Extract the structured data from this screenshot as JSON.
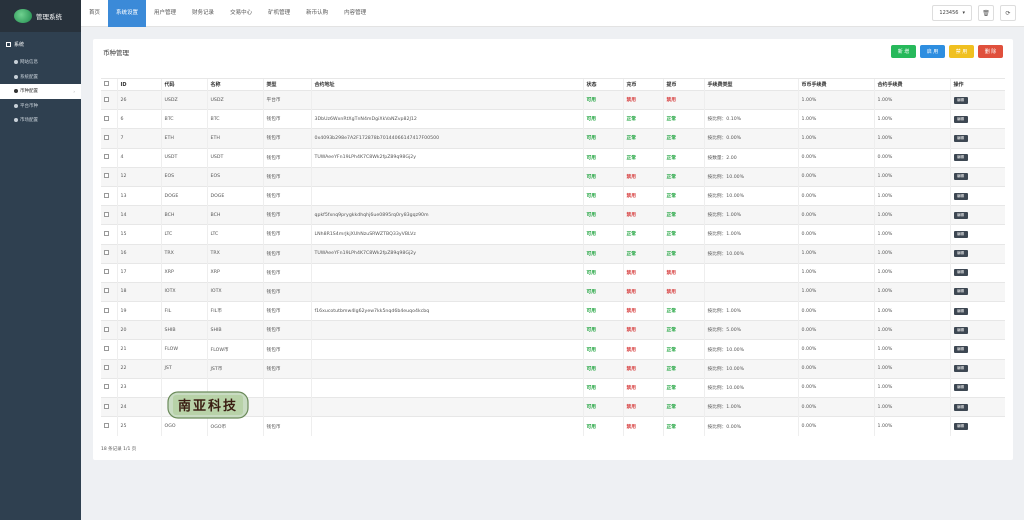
{
  "app": {
    "title": "管理系统"
  },
  "sidebar": {
    "section": "系统",
    "items": [
      {
        "label": "网站信息"
      },
      {
        "label": "系统配置"
      },
      {
        "label": "币种配置"
      },
      {
        "label": "平台币种"
      },
      {
        "label": "市场配置"
      }
    ]
  },
  "topnav": {
    "items": [
      {
        "label": "首页"
      },
      {
        "label": "系统设置"
      },
      {
        "label": "用户管理"
      },
      {
        "label": "财务记录"
      },
      {
        "label": "交易中心"
      },
      {
        "label": "矿机管理"
      },
      {
        "label": "新币认购"
      },
      {
        "label": "内容管理"
      }
    ],
    "user": "123456"
  },
  "panel": {
    "title": "币种管理",
    "actions": {
      "add": "新 增",
      "enable": "启 用",
      "disable": "禁 用",
      "delete": "删 除"
    }
  },
  "colors": {
    "add": "#27b95b",
    "enable": "#2e8ee0",
    "disable": "#f0c020",
    "delete": "#e0503c"
  },
  "table": {
    "headers": [
      "",
      "ID",
      "代码",
      "名称",
      "类型",
      "合约地址",
      "状态",
      "充币",
      "提币",
      "手续费类型",
      "币币手续费",
      "合约手续费",
      "操作"
    ],
    "rows": [
      {
        "id": "26",
        "code": "USDZ",
        "name": "USDZ",
        "type": "平台币",
        "addr": "",
        "status": "可用",
        "dep": "禁用",
        "wd": "禁用",
        "fee": "",
        "spot": "1.00%",
        "contract": "1.00%",
        "op": "编辑"
      },
      {
        "id": "6",
        "code": "BTC",
        "name": "BTC",
        "type": "钱包币",
        "addr": "3DbUz6WxnRtXgTnN4mDgiXkVaNZvp82J12",
        "status": "可用",
        "dep": "正常",
        "wd": "正常",
        "fee": "按比例：0.10%",
        "spot": "1.00%",
        "contract": "1.00%",
        "op": "编辑"
      },
      {
        "id": "7",
        "code": "ETH",
        "name": "ETH",
        "type": "钱包币",
        "addr": "0x4093b298e7A2F172878b70144066147417F00500",
        "status": "可用",
        "dep": "正常",
        "wd": "正常",
        "fee": "按比例：0.00%",
        "spot": "1.00%",
        "contract": "1.00%",
        "op": "编辑"
      },
      {
        "id": "4",
        "code": "USDT",
        "name": "USDT",
        "type": "钱包币",
        "addr": "TUWAeeYFn19LPh4K7C8Wk2fpZ89q98Gj2y",
        "status": "可用",
        "dep": "正常",
        "wd": "正常",
        "fee": "按数量：2.00",
        "spot": "0.00%",
        "contract": "0.00%",
        "op": "编辑"
      },
      {
        "id": "12",
        "code": "EOS",
        "name": "EOS",
        "type": "钱包币",
        "addr": "",
        "status": "可用",
        "dep": "禁用",
        "wd": "正常",
        "fee": "按比例：10.00%",
        "spot": "0.00%",
        "contract": "1.00%",
        "op": "编辑"
      },
      {
        "id": "13",
        "code": "DOGE",
        "name": "DOGE",
        "type": "钱包币",
        "addr": "",
        "status": "可用",
        "dep": "禁用",
        "wd": "正常",
        "fee": "按比例：10.00%",
        "spot": "0.00%",
        "contract": "1.00%",
        "op": "编辑"
      },
      {
        "id": "14",
        "code": "BCH",
        "name": "BCH",
        "type": "钱包币",
        "addr": "qpkf5fxnq9prygkkdhqhj6ue0895rq0ry83gqz90m",
        "status": "可用",
        "dep": "禁用",
        "wd": "正常",
        "fee": "按比例：1.00%",
        "spot": "0.00%",
        "contract": "1.00%",
        "op": "编辑"
      },
      {
        "id": "15",
        "code": "LTC",
        "name": "LTC",
        "type": "钱包币",
        "addr": "LNh8R1S4mrJkjXUhNzuSRWZTBQ33yVBLVz",
        "status": "可用",
        "dep": "正常",
        "wd": "正常",
        "fee": "按比例：1.00%",
        "spot": "0.00%",
        "contract": "1.00%",
        "op": "编辑"
      },
      {
        "id": "16",
        "code": "TRX",
        "name": "TRX",
        "type": "钱包币",
        "addr": "TUWAeeYFn19LPh4K7C8Wk2fpZ89q98Gj2y",
        "status": "可用",
        "dep": "正常",
        "wd": "正常",
        "fee": "按比例：10.00%",
        "spot": "1.00%",
        "contract": "1.00%",
        "op": "编辑"
      },
      {
        "id": "17",
        "code": "XRP",
        "name": "XRP",
        "type": "钱包币",
        "addr": "",
        "status": "可用",
        "dep": "禁用",
        "wd": "禁用",
        "fee": "",
        "spot": "1.00%",
        "contract": "1.00%",
        "op": "编辑"
      },
      {
        "id": "18",
        "code": "IOTX",
        "name": "IOTX",
        "type": "钱包币",
        "addr": "",
        "status": "可用",
        "dep": "禁用",
        "wd": "禁用",
        "fee": "",
        "spot": "1.00%",
        "contract": "1.00%",
        "op": "编辑"
      },
      {
        "id": "19",
        "code": "FIL",
        "name": "FIL币",
        "type": "钱包币",
        "addr": "f16xucotutbmw4lg62yew7kk5nqd6b4euqo4kcbq",
        "status": "可用",
        "dep": "禁用",
        "wd": "正常",
        "fee": "按比例：1.00%",
        "spot": "0.00%",
        "contract": "1.00%",
        "op": "编辑"
      },
      {
        "id": "20",
        "code": "SHIB",
        "name": "SHIB",
        "type": "钱包币",
        "addr": "",
        "status": "可用",
        "dep": "禁用",
        "wd": "正常",
        "fee": "按比例：5.00%",
        "spot": "0.00%",
        "contract": "1.00%",
        "op": "编辑"
      },
      {
        "id": "21",
        "code": "FLOW",
        "name": "FLOW币",
        "type": "钱包币",
        "addr": "",
        "status": "可用",
        "dep": "禁用",
        "wd": "正常",
        "fee": "按比例：10.00%",
        "spot": "0.00%",
        "contract": "1.00%",
        "op": "编辑"
      },
      {
        "id": "22",
        "code": "JST",
        "name": "JST币",
        "type": "钱包币",
        "addr": "",
        "status": "可用",
        "dep": "禁用",
        "wd": "正常",
        "fee": "按比例：10.00%",
        "spot": "0.00%",
        "contract": "1.00%",
        "op": "编辑"
      },
      {
        "id": "23",
        "code": "",
        "name": "",
        "type": "",
        "addr": "",
        "status": "可用",
        "dep": "禁用",
        "wd": "正常",
        "fee": "按比例：10.00%",
        "spot": "0.00%",
        "contract": "1.00%",
        "op": "编辑"
      },
      {
        "id": "24",
        "code": "",
        "name": "",
        "type": "",
        "addr": "",
        "status": "可用",
        "dep": "禁用",
        "wd": "正常",
        "fee": "按比例：1.00%",
        "spot": "0.00%",
        "contract": "1.00%",
        "op": "编辑"
      },
      {
        "id": "25",
        "code": "OGO",
        "name": "OGO币",
        "type": "钱包币",
        "addr": "",
        "status": "可用",
        "dep": "禁用",
        "wd": "正常",
        "fee": "按比例：0.00%",
        "spot": "0.00%",
        "contract": "1.00%",
        "op": "编辑"
      }
    ]
  },
  "footer": {
    "info": "18 条记录 1/1 页"
  },
  "watermark": {
    "text": "南亚科技"
  }
}
